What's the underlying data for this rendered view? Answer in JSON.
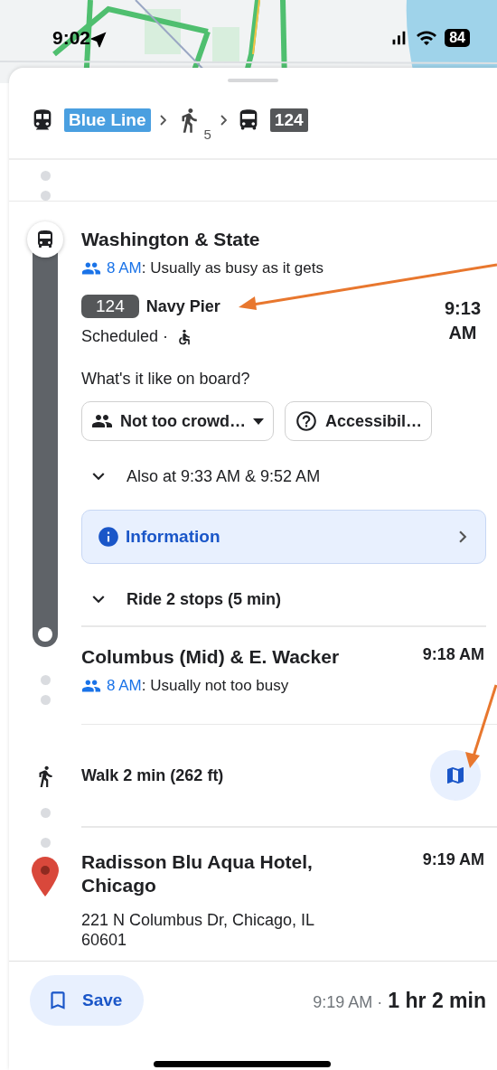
{
  "status_bar": {
    "time": "9:02",
    "battery": "84"
  },
  "route_summary": [
    {
      "kind": "train",
      "label": "Blue Line",
      "color": "#4a9fe0"
    },
    {
      "kind": "walk",
      "minutes": "5"
    },
    {
      "kind": "bus",
      "label": "124",
      "color": "#555759"
    }
  ],
  "board_stop": {
    "name": "Washington & State",
    "busy_time": "8 AM",
    "busy_text": ": Usually as busy as it gets"
  },
  "route": {
    "number": "124",
    "headsign": "Navy Pier",
    "status": "Scheduled ·",
    "wheelchair_accessible": true,
    "time": "9:13",
    "period": "AM"
  },
  "question": "What's it like on board?",
  "chips": [
    {
      "kind": "dropdown",
      "label": "Not too crowd…"
    },
    {
      "kind": "help",
      "label": "Accessibil…"
    }
  ],
  "also_at": {
    "label": "Also at 9:33 AM & 9:52 AM",
    "expanded": false
  },
  "info": {
    "label": "Information"
  },
  "ride": {
    "label": "Ride 2 stops (5 min)",
    "expanded": false
  },
  "alight_stop": {
    "name": "Columbus (Mid) & E. Wacker",
    "time": "9:18 AM",
    "busy_time": "8 AM",
    "busy_text": ": Usually not too busy"
  },
  "walk": {
    "label": "Walk 2 min (262 ft)"
  },
  "destination": {
    "name": "Radisson Blu Aqua Hotel, Chicago",
    "time": "9:19 AM",
    "address": "221 N Columbus Dr, Chicago, IL 60601"
  },
  "footer": {
    "save": "Save",
    "arrival": "9:19 AM ·",
    "duration": "1 hr 2 min"
  }
}
